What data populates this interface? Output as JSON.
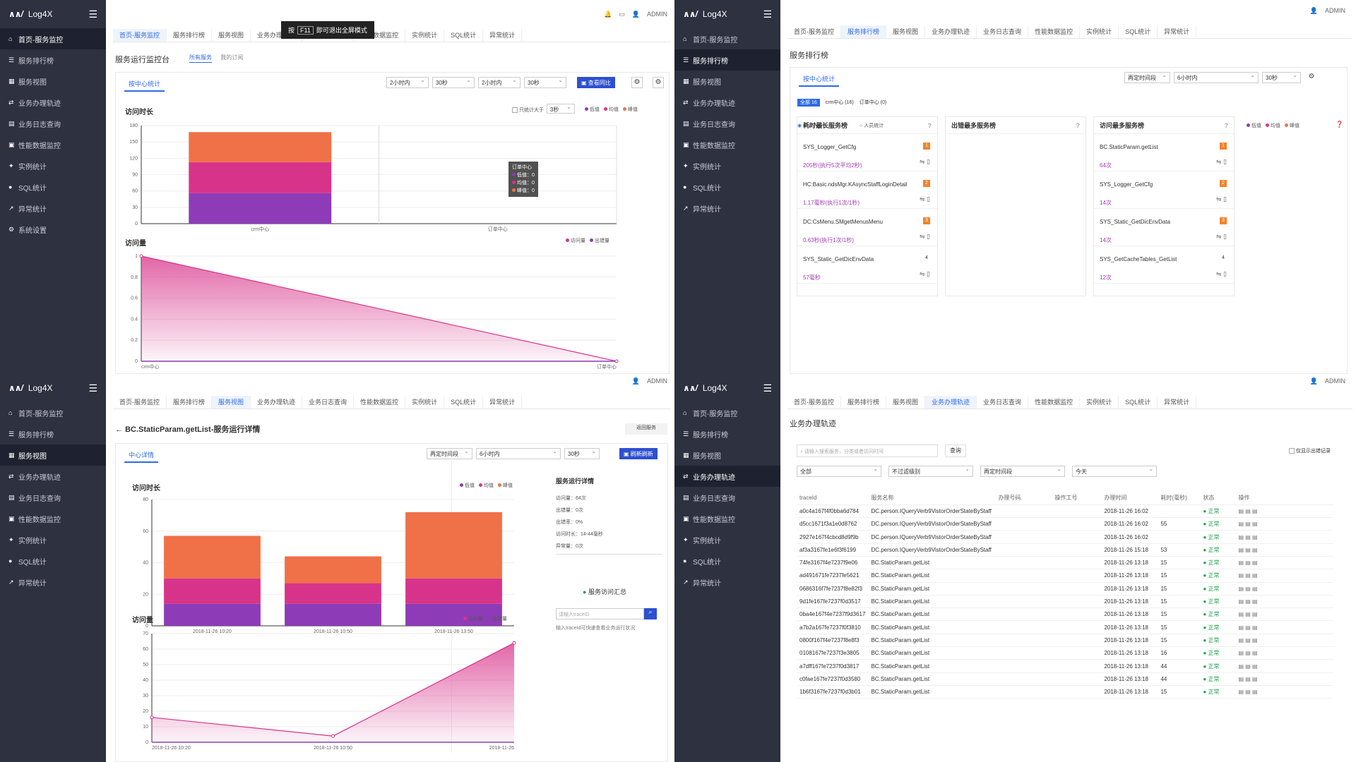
{
  "brand": "Log4X",
  "user": "ADMIN",
  "f11_hint": {
    "pre": "按",
    "key": "F11",
    "post": "即可退出全屏模式"
  },
  "sidebar_items": [
    {
      "icon": "home-icon",
      "glyph": "⌂",
      "label": "首页-服务监控"
    },
    {
      "icon": "list-icon",
      "glyph": "☰",
      "label": "服务排行榜"
    },
    {
      "icon": "grid-icon",
      "glyph": "▦",
      "label": "服务视图"
    },
    {
      "icon": "route-icon",
      "glyph": "⇄",
      "label": "业务办理轨迹"
    },
    {
      "icon": "log-icon",
      "glyph": "▤",
      "label": "业务日志查询"
    },
    {
      "icon": "chip-icon",
      "glyph": "▣",
      "label": "性能数据监控"
    },
    {
      "icon": "pin-icon",
      "glyph": "✦",
      "label": "实例统计"
    },
    {
      "icon": "db-icon",
      "glyph": "●",
      "label": "SQL统计"
    },
    {
      "icon": "trend-icon",
      "glyph": "↗",
      "label": "异常统计"
    },
    {
      "icon": "gear-icon",
      "glyph": "⚙",
      "label": "系统设置"
    }
  ],
  "tabs": [
    "首页-服务监控",
    "服务排行榜",
    "服务视图",
    "业务办理轨迹",
    "业务日志查询",
    "性能数据监控",
    "实例统计",
    "SQL统计",
    "异常统计"
  ],
  "panel_tl": {
    "title": "服务运行监控台",
    "scope_tabs": [
      "所有服务",
      "我的订阅"
    ],
    "subtab": "按中心统计",
    "selects": [
      "2小时内",
      "30秒",
      "2小时内",
      "30秒"
    ],
    "compare_btn": "查看同比",
    "only_label": "只统计大于",
    "only_value": "3秒",
    "chart1_title": "访问时长",
    "chart1_legend": [
      "低值",
      "均值",
      "峰值"
    ],
    "chart2_title": "访问量",
    "chart2_legend": [
      "访问量",
      "出错量"
    ],
    "tooltip": {
      "name": "订单中心",
      "low": "低值：0",
      "avg": "均值：0",
      "peak": "峰值：0"
    }
  },
  "panel_tr": {
    "title": "服务排行榜",
    "subtab": "按中心统计",
    "selects": [
      "再定时间段",
      "6小时内",
      "30秒"
    ],
    "filters": [
      "全部",
      "crm中心 (16)",
      "订单中心 (0)"
    ],
    "count_badge": "16",
    "radios": [
      "个人人员",
      "人员统计"
    ],
    "legend": [
      "低值",
      "均值",
      "峰值"
    ],
    "columns": [
      {
        "title": "耗时最长服务榜",
        "rows": [
          {
            "name": "SYS_Logger_GetCfg",
            "sub": "205秒(执行5次平均2秒)",
            "rank": "1"
          },
          {
            "name": "HC:Basic.ndsMgr.KAsyncStaffLoginDetail",
            "sub": "1.17毫秒(执行1次/1秒)",
            "rank": "2"
          },
          {
            "name": "DC:CsMenu.SMgetMenusMenu",
            "sub": "0.63秒(执行1次/1秒)",
            "rank": "3"
          },
          {
            "name": "SYS_Static_GetDicEnvData",
            "sub": "57毫秒",
            "rank": "4"
          }
        ]
      },
      {
        "title": "出错最多服务榜",
        "rows": []
      },
      {
        "title": "访问最多服务榜",
        "rows": [
          {
            "name": "BC.StaticParam.getList",
            "sub": "64次",
            "rank": "1"
          },
          {
            "name": "SYS_Logger_GetCfg",
            "sub": "14次",
            "rank": "2"
          },
          {
            "name": "SYS_Static_GetDicEnvData",
            "sub": "14次",
            "rank": "3"
          },
          {
            "name": "SYS_GetCacheTables_GetList",
            "sub": "12次",
            "rank": "4"
          }
        ]
      }
    ]
  },
  "panel_bl": {
    "title": "BC.StaticParam.getList-服务运行详情",
    "back_btn": "返回服务",
    "subtab": "中心详情",
    "selects": [
      "再定时间段",
      "6小时内",
      "30秒"
    ],
    "refresh_btn": "刷新刷新",
    "chart1_title": "访问时长",
    "chart1_legend": [
      "低值",
      "均值",
      "峰值"
    ],
    "chart2_title": "访问量",
    "chart2_legend": [
      "访问量",
      "出错量"
    ],
    "detail_title": "服务运行详情",
    "details": [
      "访问量：64次",
      "出错量：0次",
      "出错率：0%",
      "访问时长：14-44毫秒",
      "异常量：0次"
    ],
    "trace_title": "服务访问汇总",
    "trace_placeholder": "请输入traceID",
    "trace_hint": "输入traceId可快速查看业务运行状况"
  },
  "panel_br": {
    "title": "业务办理轨迹",
    "search_placeholder": "请输入搜索服务，分类或者访问时间",
    "search_btn": "查询",
    "checkbox": "仅显示出错记录",
    "selects": [
      "全部",
      "不过滤级别",
      "再定时间段",
      "今天"
    ],
    "headers": [
      "traceId",
      "服务名称",
      "办理号码",
      "操作工号",
      "办理时间",
      "耗时(毫秒)",
      "状态",
      "操作"
    ],
    "rows": [
      [
        "a0c4a167f4f0bba6d784",
        "DC.person.IQueryVerb9VistorOrderStateByStaff",
        "",
        "",
        "2018-11-26 16:02",
        "",
        "正常"
      ],
      [
        "d5cc1671f3a1e0d8762",
        "DC.person.IQueryVerb9VistorOrderStateByStaff",
        "",
        "",
        "2018-11-26 16:02",
        "55",
        "正常"
      ],
      [
        "2927e167f4cbcd8d9f9b",
        "DC.person.IQueryVerb9VistorOrderStateByStaff",
        "",
        "",
        "2018-11-26 16:02",
        "",
        "正常"
      ],
      [
        "af3a3167fe1e6f3f6199",
        "DC.person.IQueryVerb9VistorOrderStateByStaff",
        "",
        "",
        "2018-11-26 15:18",
        "53",
        "正常"
      ],
      [
        "74fe3167f4e7237f9e06",
        "BC.StaticParam.getList",
        "",
        "",
        "2018-11-26 13:18",
        "15",
        "正常"
      ],
      [
        "ad491671fe7237fe5621",
        "BC.StaticParam.getList",
        "",
        "",
        "2018-11-26 13:18",
        "15",
        "正常"
      ],
      [
        "0686316f7fe7237f8e82f3",
        "BC.StaticParam.getList",
        "",
        "",
        "2018-11-26 13:18",
        "15",
        "正常"
      ],
      [
        "9d1fe167fe7237f0d3517",
        "BC.StaticParam.getList",
        "",
        "",
        "2018-11-26 13:18",
        "15",
        "正常"
      ],
      [
        "0ba4e167f4e7237f9d3617",
        "BC.StaticParam.getList",
        "",
        "",
        "2018-11-26 13:18",
        "15",
        "正常"
      ],
      [
        "a7b2a167fe7237f0f3810",
        "BC.StaticParam.getList",
        "",
        "",
        "2018-11-26 13:18",
        "15",
        "正常"
      ],
      [
        "0800f167f4e7237f8e8f3",
        "BC.StaticParam.getList",
        "",
        "",
        "2018-11-26 13:18",
        "15",
        "正常"
      ],
      [
        "0108167fe7237f3e3805",
        "BC.StaticParam.getList",
        "",
        "",
        "2018-11-26 13:18",
        "16",
        "正常"
      ],
      [
        "a7dff167fe7237f0d3817",
        "BC.StaticParam.getList",
        "",
        "",
        "2018-11-26 13:18",
        "44",
        "正常"
      ],
      [
        "c0fae167fe7237f0d3580",
        "BC.StaticParam.getList",
        "",
        "",
        "2018-11-26 13:18",
        "44",
        "正常"
      ],
      [
        "1b6f3167fe7237f0d3b01",
        "BC.StaticParam.getList",
        "",
        "",
        "2018-11-26 13:18",
        "15",
        "正常"
      ]
    ]
  },
  "chart_data": [
    {
      "type": "bar",
      "title": "访问时长",
      "categories": [
        "crm中心",
        "订单中心"
      ],
      "series": [
        {
          "name": "低值",
          "values": [
            56,
            0
          ]
        },
        {
          "name": "均值",
          "values": [
            57,
            0
          ]
        },
        {
          "name": "峰值",
          "values": [
            55,
            0
          ]
        }
      ],
      "ylim": [
        0,
        180
      ],
      "yticks": [
        0,
        30,
        60,
        90,
        120,
        150,
        180
      ]
    },
    {
      "type": "area",
      "title": "访问量",
      "categories": [
        "crm中心",
        "订单中心"
      ],
      "series": [
        {
          "name": "访问量",
          "values": [
            1,
            0
          ]
        }
      ],
      "ylim": [
        0,
        1
      ],
      "yticks": [
        0,
        0.2,
        0.4,
        0.6,
        0.8,
        1
      ]
    },
    {
      "type": "bar",
      "title": "访问时长",
      "categories": [
        "2018-11-26 10:20",
        "2018-11-26 10:50",
        "2018-11-26 13:50"
      ],
      "series": [
        {
          "name": "低值",
          "values": [
            14,
            14,
            14
          ]
        },
        {
          "name": "均值",
          "values": [
            16,
            13,
            16
          ]
        },
        {
          "name": "峰值",
          "values": [
            27,
            17,
            42
          ]
        }
      ],
      "ylim": [
        0,
        80
      ],
      "yticks": [
        0,
        20,
        40,
        60,
        80
      ]
    },
    {
      "type": "area",
      "title": "访问量",
      "categories": [
        "2018-11-26 10:20",
        "2018-11-26 10:50",
        "2018-11-26"
      ],
      "series": [
        {
          "name": "访问量",
          "values": [
            16,
            4,
            64
          ]
        }
      ],
      "ylim": [
        0,
        70
      ],
      "yticks": [
        0,
        10,
        20,
        30,
        40,
        50,
        60,
        70
      ]
    }
  ],
  "colors": {
    "low": "#8e3bb8",
    "avg": "#d8338a",
    "peak": "#f07048",
    "accent": "#2e6be6",
    "sidebar": "#2d3140",
    "area": "#d8338a"
  }
}
